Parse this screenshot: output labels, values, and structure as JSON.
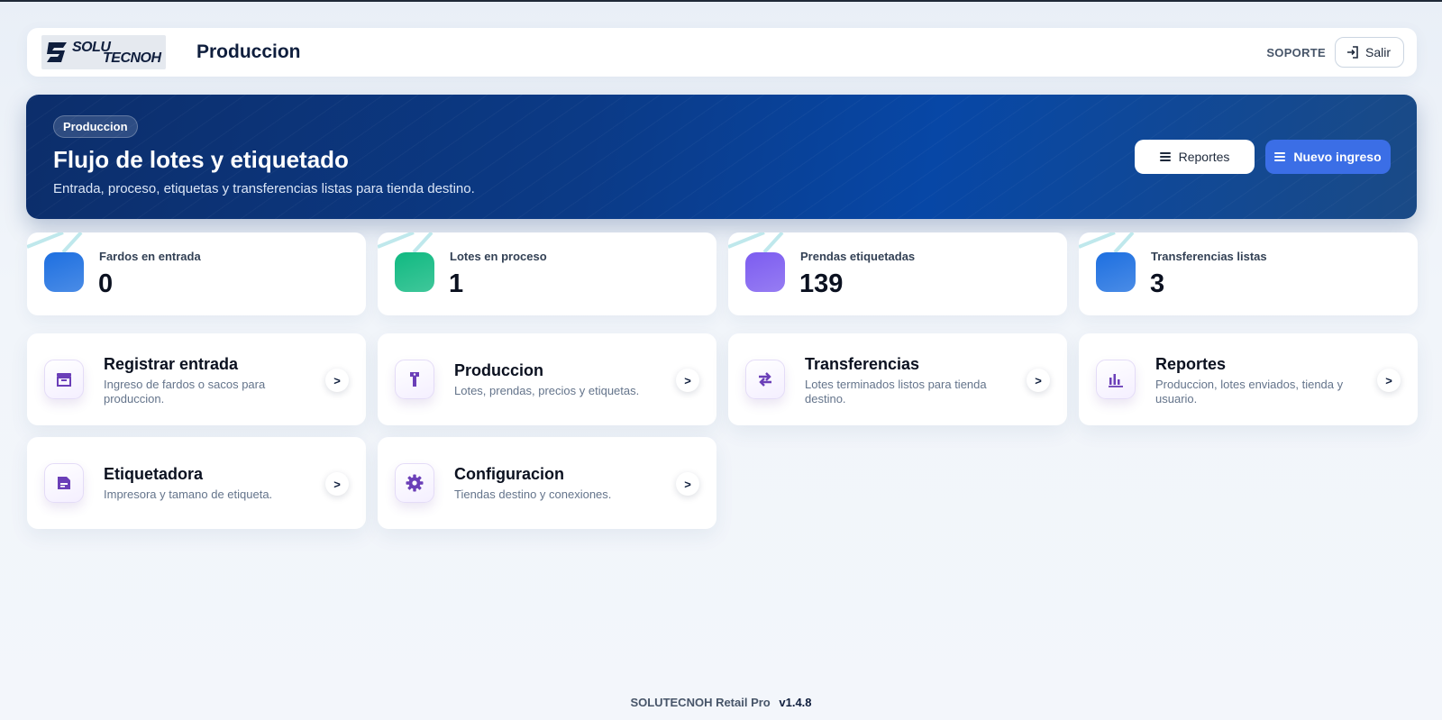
{
  "header": {
    "logo_text_top": "SOLU",
    "logo_text_bottom": "TECNOH",
    "title": "Produccion",
    "support_label": "SOPORTE",
    "logout_label": "Salir"
  },
  "hero": {
    "badge": "Produccion",
    "title": "Flujo de lotes y etiquetado",
    "subtitle": "Entrada, proceso, etiquetas y transferencias listas para tienda destino.",
    "reports_button": "Reportes",
    "new_button": "Nuevo ingreso"
  },
  "stats": [
    {
      "label": "Fardos en entrada",
      "value": "0",
      "color": "#1d6fe0"
    },
    {
      "label": "Lotes en proceso",
      "value": "1",
      "color": "#10b981"
    },
    {
      "label": "Prendas etiquetadas",
      "value": "139",
      "color": "#7c5cf0"
    },
    {
      "label": "Transferencias listas",
      "value": "3",
      "color": "#1d6fe0"
    }
  ],
  "cards": [
    {
      "title": "Registrar entrada",
      "desc": "Ingreso de fardos o sacos para produccion.",
      "icon": "inbox-icon"
    },
    {
      "title": "Produccion",
      "desc": "Lotes, prendas, precios y etiquetas.",
      "icon": "tag-icon"
    },
    {
      "title": "Transferencias",
      "desc": "Lotes terminados listos para tienda destino.",
      "icon": "transfer-icon"
    },
    {
      "title": "Reportes",
      "desc": "Produccion, lotes enviados, tienda y usuario.",
      "icon": "bar-chart-icon"
    },
    {
      "title": "Etiquetadora",
      "desc": "Impresora y tamano de etiqueta.",
      "icon": "label-icon"
    },
    {
      "title": "Configuracion",
      "desc": "Tiendas destino y conexiones.",
      "icon": "gear-icon"
    }
  ],
  "card_arrow": ">",
  "footer": {
    "product": "SOLUTECNOH Retail Pro",
    "version": "v1.4.8"
  },
  "colors": {
    "accent": "#3b6ee6",
    "icon_purple": "#6b3fb8",
    "hero_dark": "#0c2e6b"
  }
}
